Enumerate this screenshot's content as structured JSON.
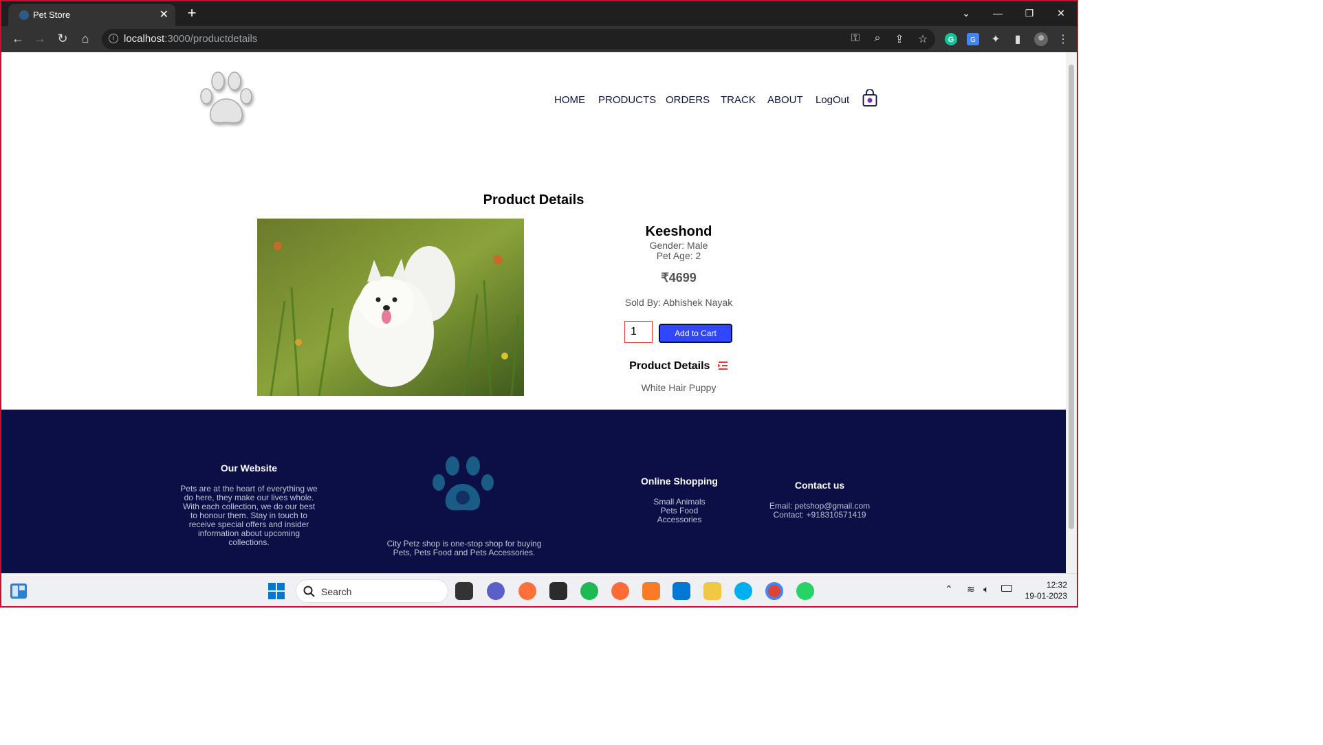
{
  "browser": {
    "tab_title": "Pet Store",
    "url_host": "localhost",
    "url_path": ":3000/productdetails",
    "tab_close": "✕",
    "new_tab": "+"
  },
  "navbar": {
    "items": [
      "HOME",
      "PRODUCTS",
      "ORDERS",
      "TRACK",
      "ABOUT",
      "LogOut"
    ]
  },
  "product": {
    "section_title": "Product Details",
    "name": "Keeshond",
    "gender": "Gender: Male",
    "age": "Pet Age: 2",
    "price": "₹4699",
    "seller": "Sold By: Abhishek Nayak",
    "quantity": "1",
    "add_to_cart": "Add to Cart",
    "details_heading": "Product Details",
    "details_text": "White Hair Puppy"
  },
  "footer": {
    "website_title": "Our Website",
    "website_text": "Pets are at the heart of everything we do here, they make our lives whole. With each collection, we do our best to honour them. Stay in touch to receive special offers and insider information about upcoming collections.",
    "tagline": "City Petz shop is one-stop shop for buying Pets, Pets Food and Pets Accessories.",
    "shopping_title": "Online Shopping",
    "shopping_links": [
      "Small Animals",
      "Pets Food",
      "Accessories"
    ],
    "contact_title": "Contact us",
    "contact_email": "Email: petshop@gmail.com",
    "contact_phone": "Contact: +918310571419"
  },
  "taskbar": {
    "search_label": "Search",
    "time": "12:32",
    "date": "19-01-2023"
  },
  "colors": {
    "accent_blue": "#3046ff",
    "footer_bg": "#0b0f45",
    "nav_text": "#0d1240",
    "paw_blue": "#1b5c86"
  }
}
